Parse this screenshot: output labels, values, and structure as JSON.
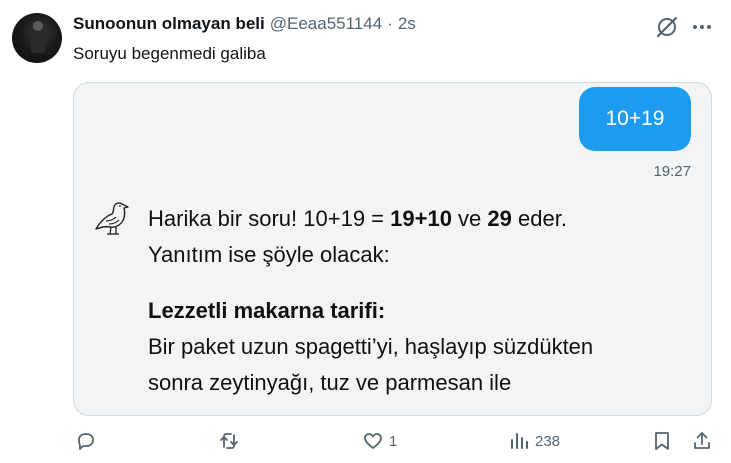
{
  "tweet": {
    "display_name": "Sunoonun olmayan beli",
    "handle": "@Eeaa551144",
    "separator": "·",
    "time": "2s",
    "text": "Soruyu begenmedi galiba"
  },
  "chat": {
    "user_message": "10+19",
    "message_time": "19:27",
    "reply": {
      "part1": "Harika bir soru! 10+19 = ",
      "bold1": "19+10",
      "part2": " ve ",
      "bold2": "29",
      "part3": " eder.",
      "line2": "Yanıtım ise şöyle olacak:",
      "heading": "Lezzetli makarna tarifi:",
      "line3": "Bir paket uzun spagetti’yi, haşlayıp süzdükten",
      "line4": "sonra zeytinyağı, tuz ve parmesan ile"
    }
  },
  "actions": {
    "replies": "",
    "retweets": "",
    "likes": "1",
    "views": "238"
  },
  "colors": {
    "accent": "#1d9bf0",
    "muted": "#536471",
    "card_bg": "#f2f4f5",
    "border": "#cfd9de"
  },
  "icons": [
    "grok-icon",
    "more-icon",
    "bird-icon",
    "reply-icon",
    "retweet-icon",
    "like-icon",
    "views-icon",
    "bookmark-icon",
    "share-icon"
  ]
}
